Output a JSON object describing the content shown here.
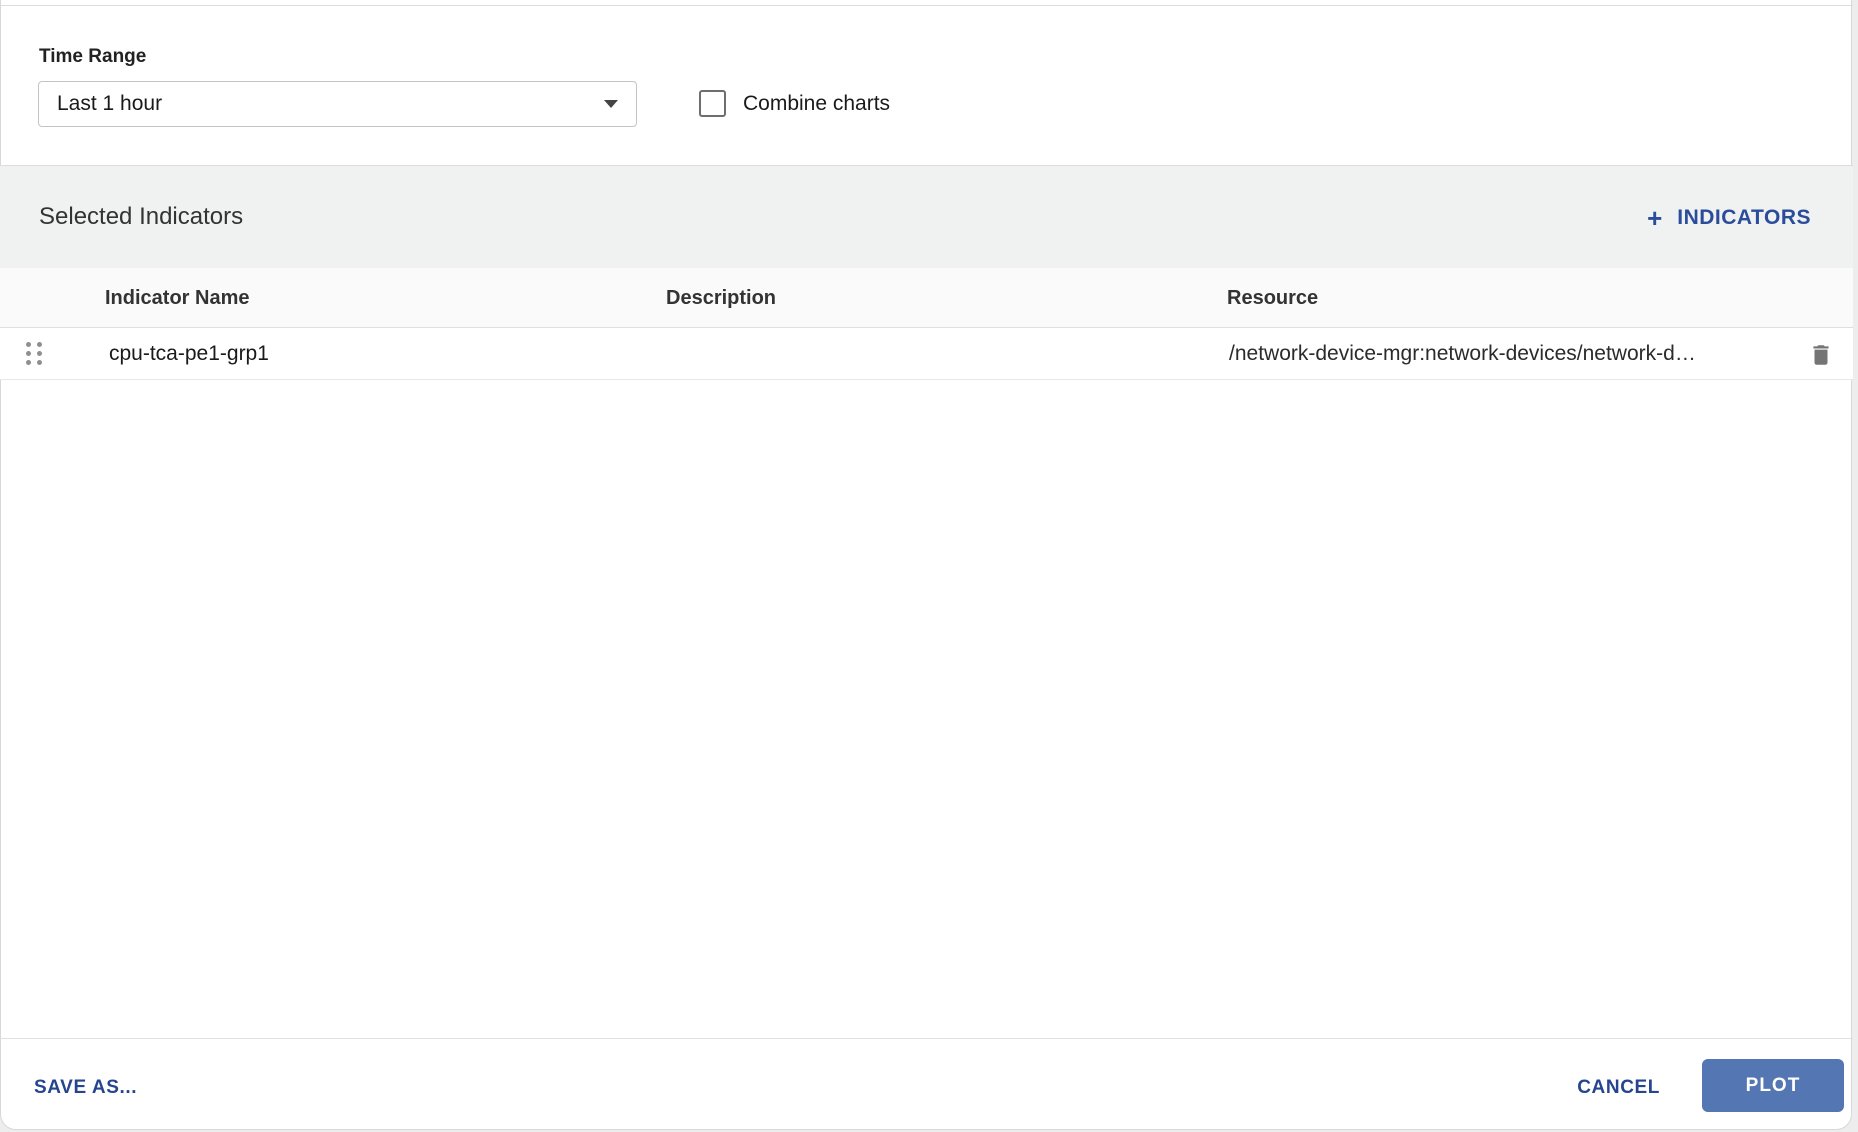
{
  "time_range": {
    "label": "Time Range",
    "value": "Last 1 hour"
  },
  "combine_charts": {
    "label": "Combine charts",
    "checked": false
  },
  "selected_indicators": {
    "title": "Selected Indicators",
    "add_button": {
      "icon": "plus-icon",
      "plus_glyph": "+",
      "label": "INDICATORS"
    },
    "table": {
      "columns": [
        "Indicator Name",
        "Description",
        "Resource"
      ],
      "rows": [
        {
          "indicator_name": "cpu-tca-pe1-grp1",
          "description": "",
          "resource": "/network-device-mgr:network-devices/network-d…"
        }
      ]
    }
  },
  "footer": {
    "save_as_label": "SAVE AS...",
    "cancel_label": "CANCEL",
    "plot_label": "PLOT"
  },
  "colors": {
    "link_blue": "#2b4c9b",
    "plot_button_bg": "#5476b3",
    "band_bg": "#f0f1f1",
    "table_header_bg": "#fafafa",
    "icon_gray": "#757575"
  }
}
